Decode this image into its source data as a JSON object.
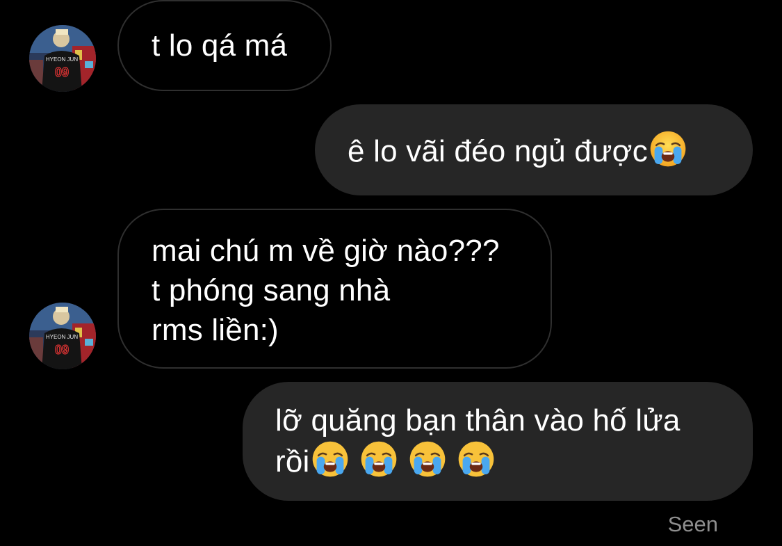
{
  "conversation": {
    "messages": [
      {
        "direction": "received",
        "text": "t lo qá má",
        "avatar": true
      },
      {
        "direction": "sent",
        "text": "ê lo vãi đéo ngủ được",
        "emoji": [
          "crying-face"
        ]
      },
      {
        "direction": "received",
        "lines": [
          "mai chú m về giờ nào???",
          "t phóng sang nhà",
          "rms liền:)"
        ],
        "avatar": true
      },
      {
        "direction": "sent",
        "lines": [
          "lỡ quăng bạn thân vào hố lửa",
          "rồi"
        ],
        "emoji": [
          "crying-face",
          "crying-face",
          "crying-face",
          "crying-face"
        ]
      }
    ],
    "status": "Seen",
    "avatar_jersey_text": "HYEON JUN",
    "avatar_jersey_number": "09"
  },
  "colors": {
    "background": "#000000",
    "sent_bubble": "#262626",
    "received_border": "#2f2f2f",
    "text": "#ffffff",
    "status_text": "#8e8e8e"
  }
}
